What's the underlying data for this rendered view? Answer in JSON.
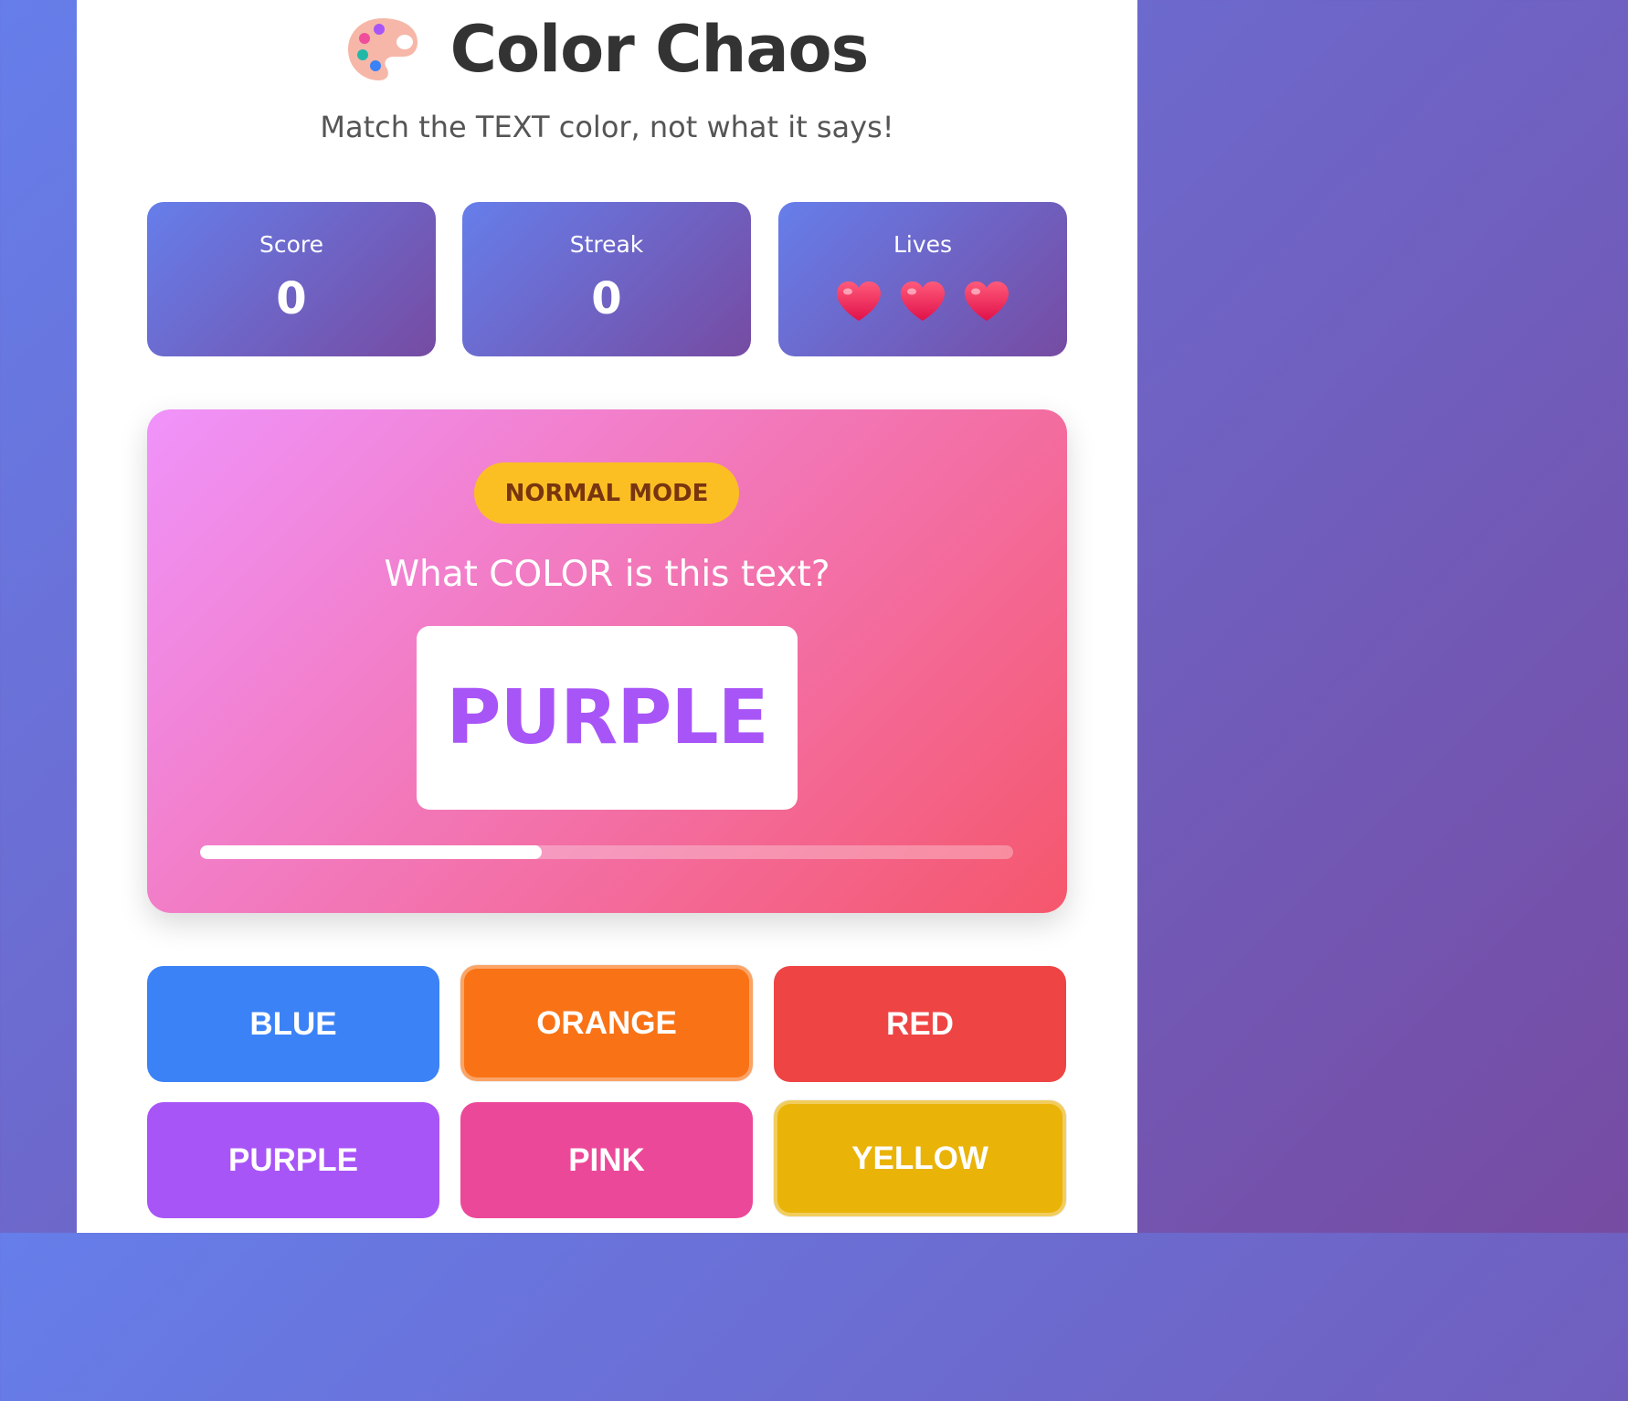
{
  "header": {
    "icon": "palette-icon",
    "title": "Color Chaos",
    "subtitle": "Match the TEXT color, not what it says!"
  },
  "stats": {
    "score": {
      "label": "Score",
      "value": "0"
    },
    "streak": {
      "label": "Streak",
      "value": "0"
    },
    "lives": {
      "label": "Lives",
      "count": 3,
      "icon": "heart-icon"
    }
  },
  "game": {
    "mode": "NORMAL MODE",
    "question": "What COLOR is this text?",
    "word": "PURPLE",
    "word_color": "#a855f7",
    "timer_fraction": 0.42
  },
  "choices": [
    {
      "label": "BLUE",
      "color": "#3b82f6"
    },
    {
      "label": "ORANGE",
      "color": "#f97316"
    },
    {
      "label": "RED",
      "color": "#ef4444"
    },
    {
      "label": "PURPLE",
      "color": "#a855f7"
    },
    {
      "label": "PINK",
      "color": "#ec4899"
    },
    {
      "label": "YELLOW",
      "color": "#eab308"
    }
  ]
}
